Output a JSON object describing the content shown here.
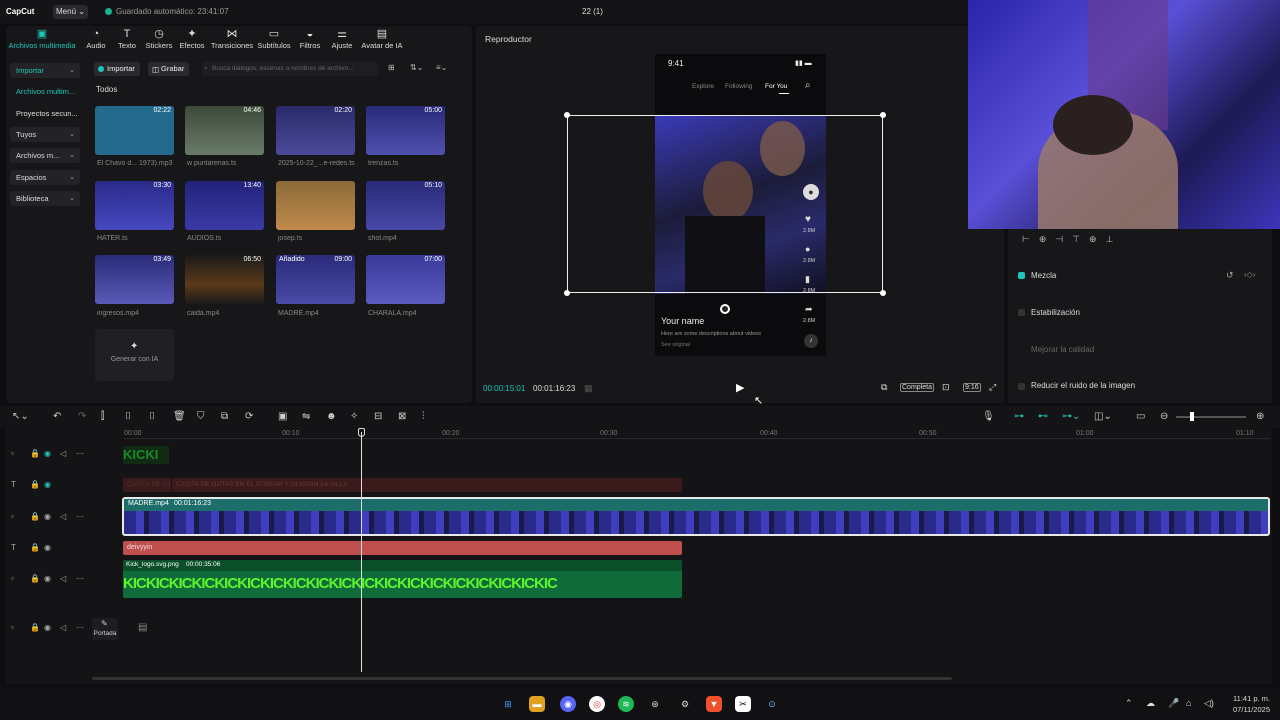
{
  "topbar": {
    "logo": "CapCut",
    "menu": "Menú",
    "autosave": "Guardado automático: 23:41:07",
    "project_title": "22 (1)"
  },
  "toolbar_tabs": [
    {
      "label": "Archivos multimedia",
      "icon": "media-icon"
    },
    {
      "label": "Audio",
      "icon": "audio-icon"
    },
    {
      "label": "Texto",
      "icon": "text-icon"
    },
    {
      "label": "Stickers",
      "icon": "sticker-icon"
    },
    {
      "label": "Efectos",
      "icon": "effects-icon"
    },
    {
      "label": "Transiciones",
      "icon": "transition-icon"
    },
    {
      "label": "Subtítulos",
      "icon": "subtitle-icon"
    },
    {
      "label": "Filtros",
      "icon": "filter-icon"
    },
    {
      "label": "Ajuste",
      "icon": "adjust-icon"
    },
    {
      "label": "Avatar de IA",
      "icon": "avatar-icon"
    }
  ],
  "sidebar": {
    "items": [
      {
        "label": "Importar"
      },
      {
        "label": "Archivos multim..."
      },
      {
        "label": "Proyectos secun..."
      },
      {
        "label": "Tuyos"
      },
      {
        "label": "Archivos m..."
      },
      {
        "label": "Espacios"
      },
      {
        "label": "Biblioteca"
      }
    ]
  },
  "media": {
    "import_btn": "Importar",
    "record_btn": "Grabar",
    "search_placeholder": "Busca diálogos, escenas o nombres de archivo...",
    "section": "Todos",
    "items": [
      {
        "name": "El Chavo d... 1973).mp3",
        "dur": "02:22"
      },
      {
        "name": "w puntarenas.ts",
        "dur": "04:46"
      },
      {
        "name": "2025-10-22_...e-redes.ts",
        "dur": "02:20"
      },
      {
        "name": "trenzas.ts",
        "dur": "05:00"
      },
      {
        "name": "HATER.ts",
        "dur": "03:30"
      },
      {
        "name": "AUDIOS.ts",
        "dur": "13:40"
      },
      {
        "name": "josep.ts",
        "dur": ""
      },
      {
        "name": "shot.mp4",
        "dur": "05:10"
      },
      {
        "name": "ingresos.mp4",
        "dur": "03:49"
      },
      {
        "name": "caida.mp4",
        "dur": "06:50"
      },
      {
        "name": "MADRE.mp4",
        "dur": "09:00",
        "badge": "Añadido"
      },
      {
        "name": "CHARALA.mp4",
        "dur": "07:00"
      }
    ],
    "generate_ai": "Generar con IA"
  },
  "player": {
    "title": "Reproductor",
    "current": "00:00:15:01",
    "total": "00:01:16:23",
    "ratio_btn": "Completa",
    "aspect": "9:16",
    "phone": {
      "time": "9:41",
      "tabs": [
        "Explore",
        "Following",
        "For You"
      ],
      "user": "Your name",
      "desc": "Here are some descriptions about videos",
      "sound": "See original",
      "likes": "2.8M",
      "comments": "2.8M",
      "saves": "2.8M",
      "shares": "2.8M"
    }
  },
  "props": {
    "mezcla": "Mezcla",
    "estabilizacion": "Estabilización",
    "mejorar": "Mejorar la calidad",
    "ruido": "Reducir el ruido de la imagen"
  },
  "timeline": {
    "ticks": [
      "00:00",
      "00:10",
      "00:20",
      "00:30",
      "00:40",
      "00:50",
      "01:00",
      "01:10"
    ],
    "clip_main": {
      "name": "MADRE.mp4",
      "dur": "00:01:16:23"
    },
    "clip_text_top": "CASITA DE OJITAS EN EL STREAM Y OLVIDAN LA SILLA",
    "clip_text_top_short": "CASITA DE OJI",
    "clip_red": "deivyyin",
    "clip_logo": {
      "name": "Kick_logo.svg.png",
      "dur": "00:00:35:06",
      "text": "KICKICKICKICKICKICKICKICKICKICKICKICKICKICKICKICKICKICKIC"
    },
    "kick_small": "KICKI",
    "cover": "Portada"
  },
  "taskbar": {
    "time": "11:41 p. m.",
    "date": "07/11/2025"
  },
  "colors": {
    "accent": "#1fc4b8",
    "main_clip": "#1d6e6a",
    "red_clip": "#c0504d",
    "logo_clip": "#0f6b3a"
  }
}
